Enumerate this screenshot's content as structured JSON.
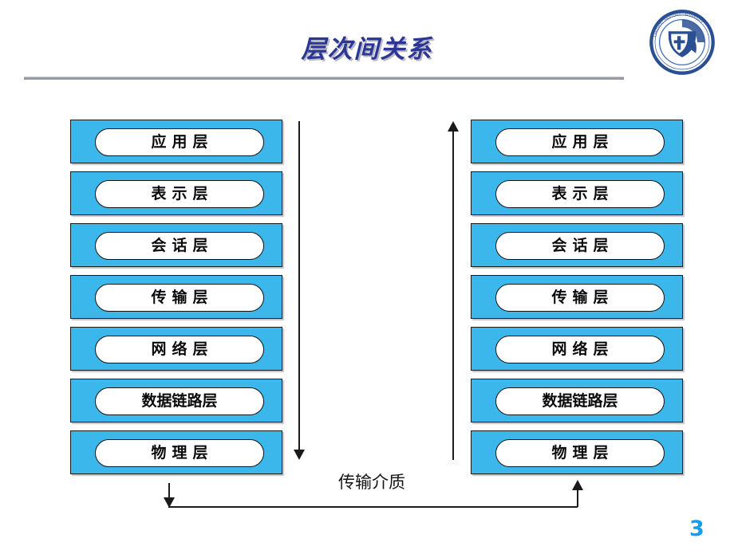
{
  "slide": {
    "title": "层次间关系",
    "page_number": "3",
    "background_color": "#ffffff",
    "title_color": "#2c3795",
    "title_shadow_color": "#b9b9c4",
    "divider_color": "#9a9aa3",
    "page_number_color": "#139ff0"
  },
  "logo": {
    "name": "lanzhou-jiaotong-university-emblem",
    "ring_text": "LANZHOU JIAOTONG UNIVERSITY",
    "color_dark": "#2b4f93",
    "color_mid": "#3f6fb5",
    "color_light": "#ffffff"
  },
  "diagram": {
    "box_fill_color": "#3cb7ec",
    "box_border_color": "#1b1b1b",
    "pill_fill_color": "#ffffff",
    "label_color": "#0a0a0a",
    "left_stack": {
      "name": "sender-protocol-stack",
      "layers": [
        {
          "label": "应用层",
          "tight": false
        },
        {
          "label": "表示层",
          "tight": false
        },
        {
          "label": "会话层",
          "tight": false
        },
        {
          "label": "传输层",
          "tight": false
        },
        {
          "label": "网络层",
          "tight": false
        },
        {
          "label": "数据链路层",
          "tight": true
        },
        {
          "label": "物理层",
          "tight": false
        }
      ]
    },
    "right_stack": {
      "name": "receiver-protocol-stack",
      "layers": [
        {
          "label": "应用层",
          "tight": false
        },
        {
          "label": "表示层",
          "tight": false
        },
        {
          "label": "会话层",
          "tight": false
        },
        {
          "label": "传输层",
          "tight": false
        },
        {
          "label": "网络层",
          "tight": false
        },
        {
          "label": "数据链路层",
          "tight": true
        },
        {
          "label": "物理层",
          "tight": false
        }
      ]
    },
    "down_arrow_label": "",
    "up_arrow_label": "",
    "medium_label": "传输介质"
  }
}
